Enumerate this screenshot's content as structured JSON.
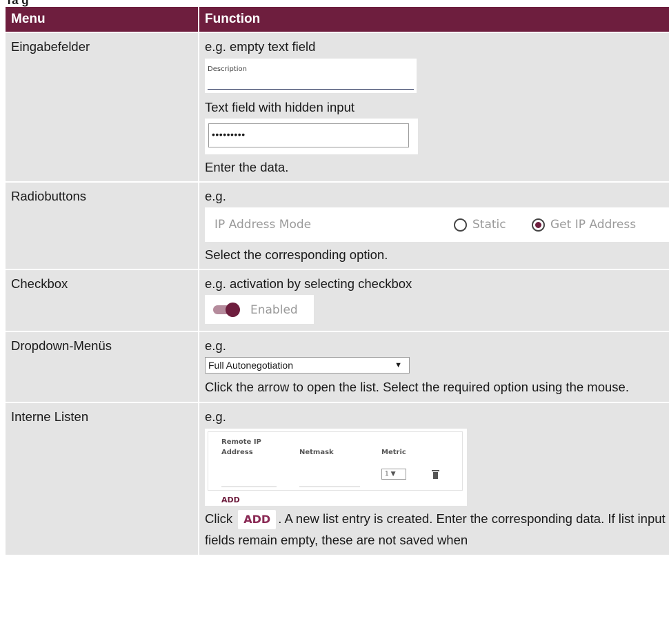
{
  "page": {
    "top_fragment": "Ta g"
  },
  "table": {
    "headers": {
      "menu": "Menu",
      "function": "Function"
    },
    "rows": {
      "input": {
        "menu": "Eingabefelder",
        "line1": "e.g. empty text field",
        "desc_label": "Description",
        "line2": "Text field with hidden input",
        "password_value": "•••••••••",
        "line3": "Enter the data."
      },
      "radio": {
        "menu": "Radiobuttons",
        "line1": "e.g.",
        "field_label": "IP Address Mode",
        "option1": "Static",
        "option2": "Get IP Address",
        "selected": "Get IP Address",
        "line2": "Select the corresponding option."
      },
      "checkbox": {
        "menu": "Checkbox",
        "line1": "e.g. activation by selecting checkbox",
        "toggle_label": "Enabled",
        "toggle_on": true
      },
      "dropdown": {
        "menu": "Dropdown-Menüs",
        "line1": "e.g.",
        "select_value": "Full Autonegotiation",
        "arrow": "▼",
        "line2": "Click the arrow to open the list. Select the required option using the mouse."
      },
      "list": {
        "menu": "Interne Listen",
        "line1": "e.g.",
        "col1_line1": "Remote IP",
        "col1_line2": "Address",
        "col2": "Netmask",
        "col3": "Metric",
        "metric_value": "1 ▼",
        "add_label": "ADD",
        "text_before": "Click",
        "inline_add": "ADD",
        "text_after": ". A new list entry is created. Enter the corresponding data. If list input fields remain empty, these are not saved when"
      }
    }
  },
  "colors": {
    "header_bg": "#6e1e3e",
    "cell_bg": "#e4e4e4",
    "accent": "#6e1e3e"
  },
  "icons": {
    "trash": "trash-icon"
  }
}
